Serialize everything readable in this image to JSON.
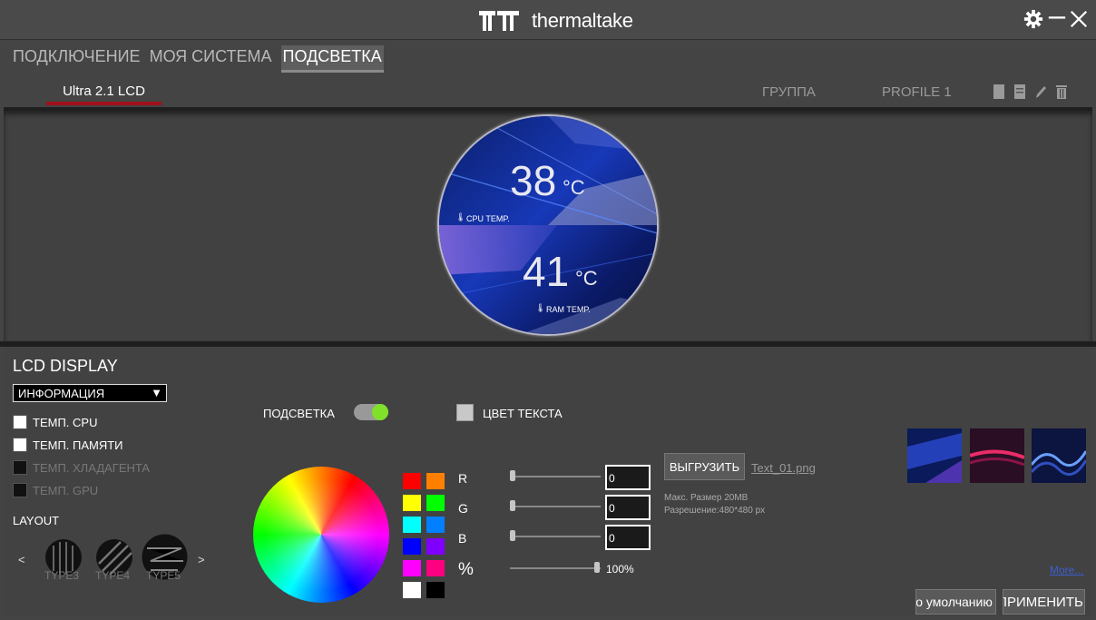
{
  "app": {
    "brand": "thermaltake"
  },
  "window_controls": {
    "settings_icon": "gear-icon",
    "minimize_icon": "minimize-icon",
    "close_icon": "close-icon"
  },
  "top_nav": {
    "tabs": [
      {
        "label": "ПОДКЛЮЧЕНИЕ",
        "active": false
      },
      {
        "label": "МОЯ СИСТЕМА",
        "active": false
      },
      {
        "label": "ПОДСВЕТКА",
        "active": true
      }
    ]
  },
  "device_bar": {
    "device_tab": "Ultra 2.1 LCD",
    "group_label": "ГРУППА",
    "profile_label": "PROFILE 1",
    "icons": [
      "save-icon",
      "load-icon",
      "edit-icon",
      "delete-icon"
    ]
  },
  "preview": {
    "cpu_value": "38",
    "cpu_unit": "°C",
    "cpu_label": "CPU TEMP.",
    "ram_value": "41",
    "ram_unit": "°C",
    "ram_label": "RAM TEMP."
  },
  "lcd_panel": {
    "heading": "LCD DISPLAY",
    "mode_select": "ИНФОРМАЦИЯ",
    "checkboxes": [
      {
        "label": "ТЕМП. CPU",
        "checked": true,
        "enabled": true
      },
      {
        "label": "ТЕМП. ПАМЯТИ",
        "checked": true,
        "enabled": true
      },
      {
        "label": "ТЕМП. ХЛАДАГЕНТА",
        "checked": false,
        "enabled": false
      },
      {
        "label": "ТЕМП. GPU",
        "checked": false,
        "enabled": false
      }
    ],
    "layout_label": "LAYOUT",
    "layout_prev": "<",
    "layout_next": ">",
    "layout_types": [
      "TYPE3",
      "TYPE4",
      "TYPE5"
    ]
  },
  "lighting": {
    "backlight_label": "ПОДСВЕТКА",
    "backlight_on": true,
    "text_color_label": "ЦВЕТ ТЕКСТА",
    "text_color_value": "#c8c8c8",
    "swatches": [
      "#ff0000",
      "#ff8000",
      "#ffff00",
      "#00ff00",
      "#00ffff",
      "#0080ff",
      "#0000ff",
      "#8000ff",
      "#ff00ff",
      "#ff0080",
      "#ffffff",
      "#000000"
    ],
    "rgb": {
      "r_label": "R",
      "r_value": "0",
      "g_label": "G",
      "g_value": "0",
      "b_label": "B",
      "b_value": "0",
      "brightness_label": "%",
      "brightness_value": "100%",
      "brightness_fraction": 1.0
    }
  },
  "upload": {
    "button": "ВЫГРУЗИТЬ",
    "file_name": "Text_01.png",
    "max_size": "Макс. Размер 20MB",
    "resolution": "Разрешение:480*480 px"
  },
  "backgrounds": {
    "more_link": "More..."
  },
  "footer": {
    "default_button": "По умолчанию",
    "apply_button": "ПРИМЕНИТЬ"
  },
  "colors": {
    "accent_red": "#a0101a",
    "toggle_on": "#7fe12a"
  }
}
